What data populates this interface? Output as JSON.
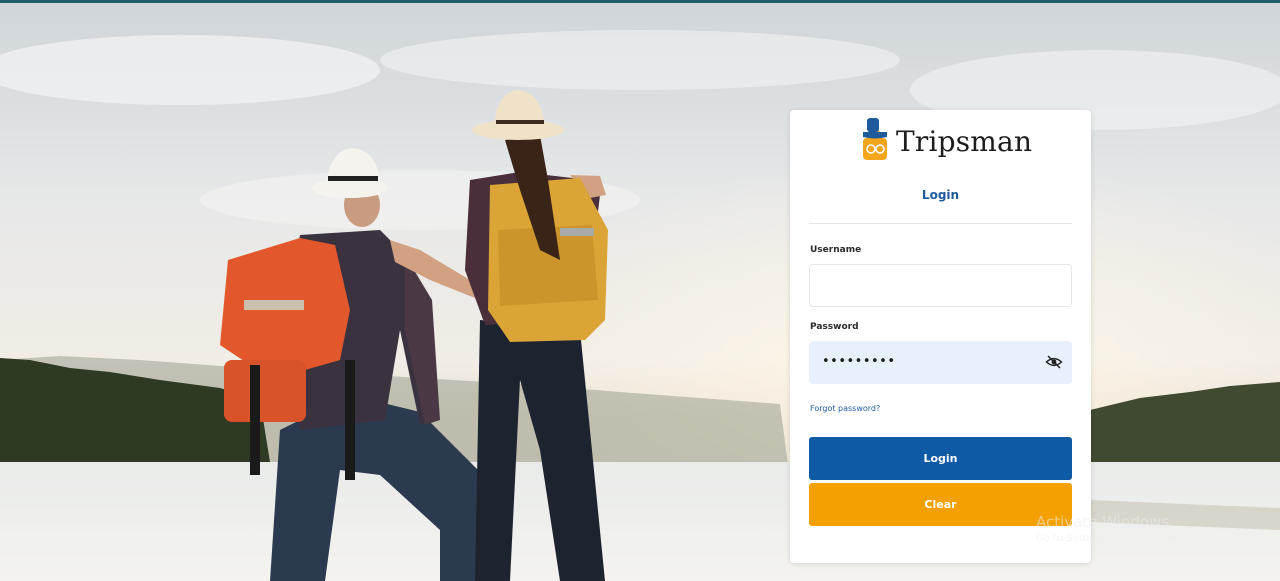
{
  "app": {
    "brand_name": "Tripsman",
    "page_title": "Login"
  },
  "form": {
    "username_label": "Username",
    "username_value": "",
    "password_label": "Password",
    "password_value": "•••••••••",
    "forgot_password": "Forgot password?",
    "login_button": "Login",
    "clear_button": "Clear"
  },
  "watermark": {
    "title": "Activate Windows",
    "subtitle": "Go to Settings to activate Windows."
  },
  "colors": {
    "primary": "#0e5aa5",
    "accent": "#f4a100",
    "title_blue": "#1e5a9c",
    "password_bg": "#e8f0fe"
  },
  "icons": {
    "logo": "suitcase-with-hat-icon",
    "password_toggle": "eye-slash-icon"
  }
}
